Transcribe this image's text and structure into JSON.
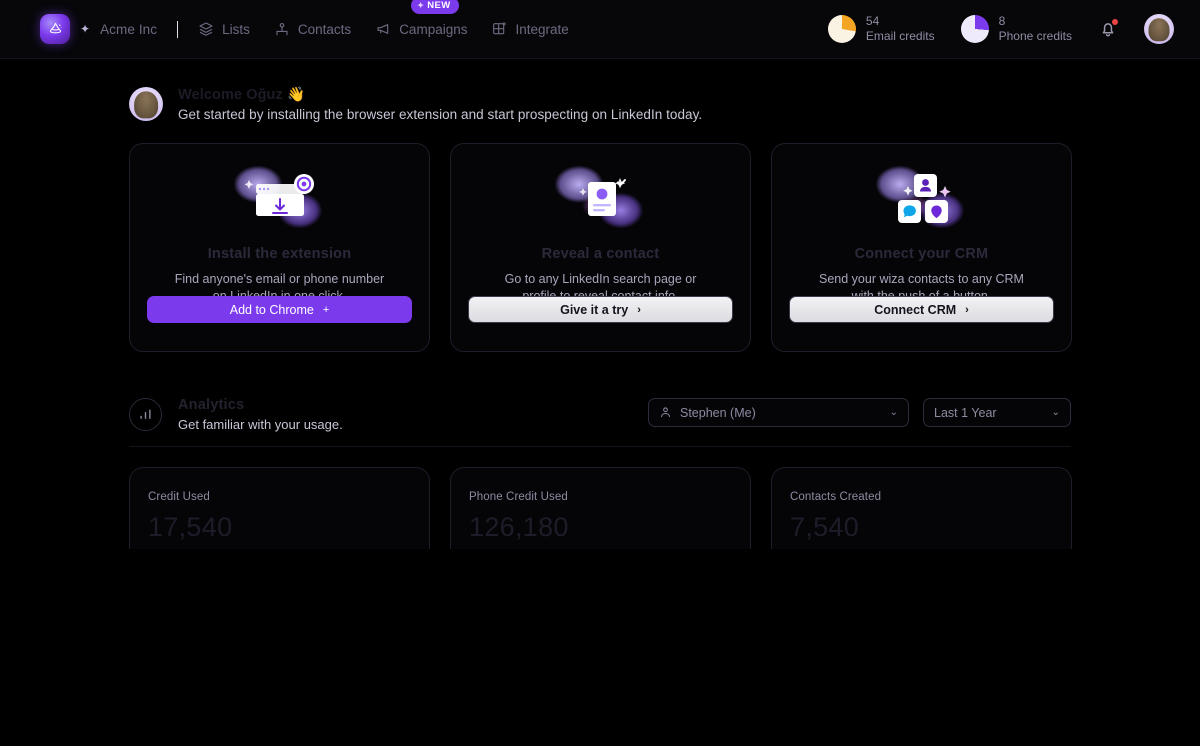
{
  "navbar": {
    "logo_icon": "wizard-hat-logo",
    "spark_icon": "sparkle-icon",
    "workspace": "Acme Inc",
    "items": [
      {
        "label": "Lists",
        "icon": "layers-icon"
      },
      {
        "label": "Contacts",
        "icon": "users-icon"
      },
      {
        "label": "Campaigns",
        "icon": "megaphone-icon",
        "badge": "NEW"
      },
      {
        "label": "Integrate",
        "icon": "grid-plus-icon"
      }
    ],
    "email_credits": {
      "value": "54",
      "label": "Email credits",
      "color": "#f5a524",
      "track": "#faf2e3"
    },
    "phone_credits": {
      "value": "8",
      "label": "Phone credits",
      "color": "#7c3aed",
      "track": "#eee9fb"
    },
    "bell_icon": "notification-bell-icon",
    "avatar": "user-avatar"
  },
  "welcome": {
    "title": "Welcome Oğuz 👋",
    "subtitle": "Get started by installing the browser extension and start prospecting on LinkedIn today."
  },
  "onboarding": {
    "cards": [
      {
        "illustration": "browser-download-illustration",
        "title": "Install the extension",
        "description": "Find anyone's email or phone number on LinkedIn in one click.",
        "button": {
          "label": "Add to Chrome",
          "icon": "plus-icon",
          "style": "primary"
        }
      },
      {
        "illustration": "contact-card-illustration",
        "title": "Reveal a contact",
        "description": "Go to any LinkedIn search page or profile to reveal contact info.",
        "button": {
          "label": "Give it a try",
          "icon": "chevron-right-icon",
          "style": "ghost"
        }
      },
      {
        "illustration": "crm-apps-illustration",
        "title": "Connect your CRM",
        "description": "Send your wiza contacts to any CRM with the push of a button.",
        "button": {
          "label": "Connect CRM",
          "icon": "chevron-right-icon",
          "style": "ghost"
        }
      }
    ]
  },
  "analytics": {
    "icon": "bar-chart-icon",
    "title": "Analytics",
    "subtitle": "Get familiar with your usage.",
    "people_filter": {
      "value": "Stephen (Me)",
      "icon": "person-icon"
    },
    "range_filter": {
      "value": "Last 1 Year"
    },
    "stats": [
      {
        "label": "Credit Used",
        "value": "17,540"
      },
      {
        "label": "Phone Credit Used",
        "value": "126,180"
      },
      {
        "label": "Contacts Created",
        "value": "7,540"
      }
    ]
  },
  "colors": {
    "accent": "#7c3aed",
    "background": "#000000",
    "card_border": "#1e1e2b"
  }
}
